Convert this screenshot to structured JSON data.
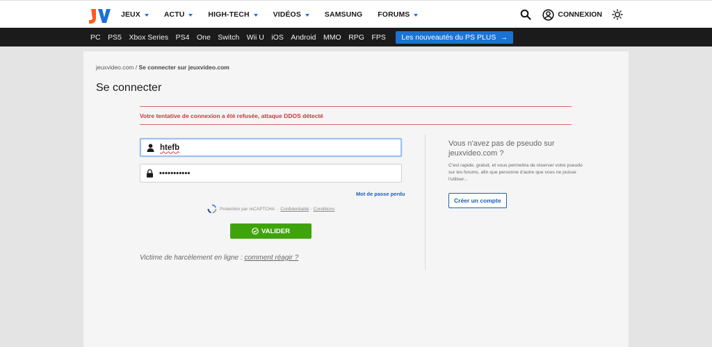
{
  "header": {
    "logo_text": "JV",
    "nav": [
      {
        "label": "JEUX",
        "has_menu": true
      },
      {
        "label": "ACTU",
        "has_menu": true
      },
      {
        "label": "HIGH-TECH",
        "has_menu": true
      },
      {
        "label": "VIDÉOS",
        "has_menu": true
      },
      {
        "label": "SAMSUNG",
        "has_menu": false
      },
      {
        "label": "FORUMS",
        "has_menu": true
      }
    ],
    "search_icon": "search-icon",
    "account_label": "CONNEXION",
    "account_icon": "user-circle-icon",
    "theme_icon": "sun-icon"
  },
  "subnav": {
    "items": [
      "PC",
      "PS5",
      "Xbox Series",
      "PS4",
      "One",
      "Switch",
      "Wii U",
      "iOS",
      "Android",
      "MMO",
      "RPG",
      "FPS"
    ],
    "promo_label": "Les nouveautés du PS PLUS",
    "promo_color": "#1a73d4"
  },
  "breadcrumb": {
    "home": "jeuxvideo.com",
    "separator": "/",
    "current": "Se connecter sur jeuxvideo.com"
  },
  "page_title": "Se connecter",
  "error_message": "Votre tentative de connexion a été refusée, attaque DDOS détecté",
  "login": {
    "username_value": "htefb",
    "password_value": "•••••••••••",
    "forgot_label": "Mot de passe perdu",
    "recaptcha_text": "Protection par reCAPTCHA",
    "recaptcha_sep": "·",
    "privacy_label": "Confidentialité",
    "terms_sep": "-",
    "terms_label": "Conditions",
    "submit_label": "VALIDER",
    "submit_color": "#3fa40c",
    "harass_text": "Victime de harcèlement en ligne :",
    "harass_link": "comment réagir ?"
  },
  "signup": {
    "title": "Vous n'avez pas de pseudo sur jeuxvideo.com ?",
    "description": "C'est rapide, gratuit, et vous permettra de réserver votre pseudo sur les forums, afin que personne d'autre que vous ne puisse l'utiliser...",
    "button_label": "Créer un compte"
  }
}
